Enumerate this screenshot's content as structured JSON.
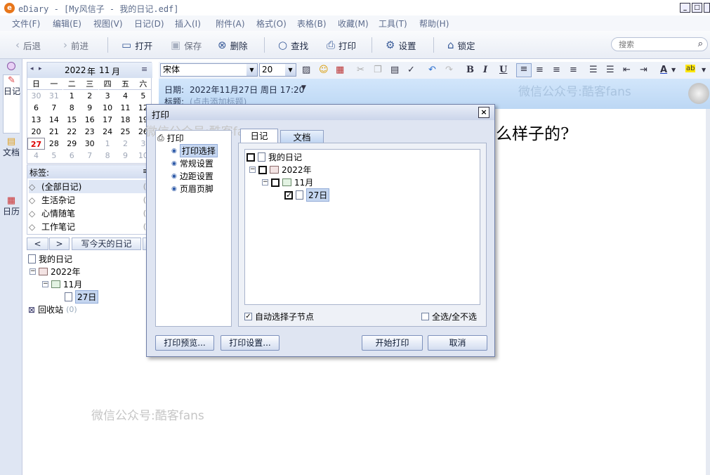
{
  "window": {
    "title": "eDiary - [My风信子 - 我的日记.edf]",
    "buttons": [
      "_",
      "□",
      "×"
    ]
  },
  "menubar": [
    "文件(F)",
    "编辑(E)",
    "视图(V)",
    "日记(D)",
    "插入(I)",
    "附件(A)",
    "格式(O)",
    "表格(B)",
    "收藏(M)",
    "工具(T)",
    "帮助(H)"
  ],
  "toolbar": {
    "back": "后退",
    "forward": "前进",
    "open": "打开",
    "save": "保存",
    "delete": "删除",
    "find": "查找",
    "print": "打印",
    "settings": "设置",
    "lock": "锁定",
    "search_placeholder": "搜索"
  },
  "vtabs": [
    "日记",
    "文档",
    "日历"
  ],
  "calendar": {
    "year": "2022",
    "year_unit": "年",
    "month": "11",
    "month_unit": "月",
    "weekdays": [
      "日",
      "一",
      "二",
      "三",
      "四",
      "五",
      "六"
    ],
    "rows": [
      [
        "30",
        "31",
        "1",
        "2",
        "3",
        "4",
        "5"
      ],
      [
        "6",
        "7",
        "8",
        "9",
        "10",
        "11",
        "12"
      ],
      [
        "13",
        "14",
        "15",
        "16",
        "17",
        "18",
        "19"
      ],
      [
        "20",
        "21",
        "22",
        "23",
        "24",
        "25",
        "26"
      ],
      [
        "27",
        "28",
        "29",
        "30",
        "1",
        "2",
        "3"
      ],
      [
        "4",
        "5",
        "6",
        "7",
        "8",
        "9",
        "10"
      ]
    ],
    "today": "27"
  },
  "tags": {
    "header": "标签:",
    "items": [
      {
        "label": "(全部日记)",
        "count": "(1"
      },
      {
        "label": "生活杂记",
        "count": "(0"
      },
      {
        "label": "心情随笔",
        "count": "(0"
      },
      {
        "label": "工作笔记",
        "count": "(0"
      }
    ]
  },
  "nav": {
    "prev": "<",
    "next": ">",
    "write_today": "写今天的日记"
  },
  "tree": {
    "root": "我的日记",
    "year": "2022年",
    "month": "11月",
    "day": "27日",
    "recycle": "回收站",
    "recycle_count": "(0)"
  },
  "format": {
    "font": "宋体",
    "size": "20"
  },
  "editor": {
    "date_label": "日期:",
    "date_value": "2022年11月27日 周日 17:20",
    "title_label": "标题:",
    "title_placeholder": "(点击添加标题)",
    "content": "么样子的?"
  },
  "watermark": "微信公众号:酷客fans",
  "dialog": {
    "title": "打印",
    "tree_root": "打印",
    "tree_items": [
      "打印选择",
      "常规设置",
      "边距设置",
      "页眉页脚"
    ],
    "tabs": [
      "日记",
      "文档"
    ],
    "items": {
      "root": "我的日记",
      "year": "2022年",
      "month": "11月",
      "day": "27日"
    },
    "auto_select": "自动选择子节点",
    "select_all": "全选/全不选",
    "buttons": {
      "preview": "打印预览...",
      "setup": "打印设置...",
      "start": "开始打印",
      "cancel": "取消"
    }
  }
}
